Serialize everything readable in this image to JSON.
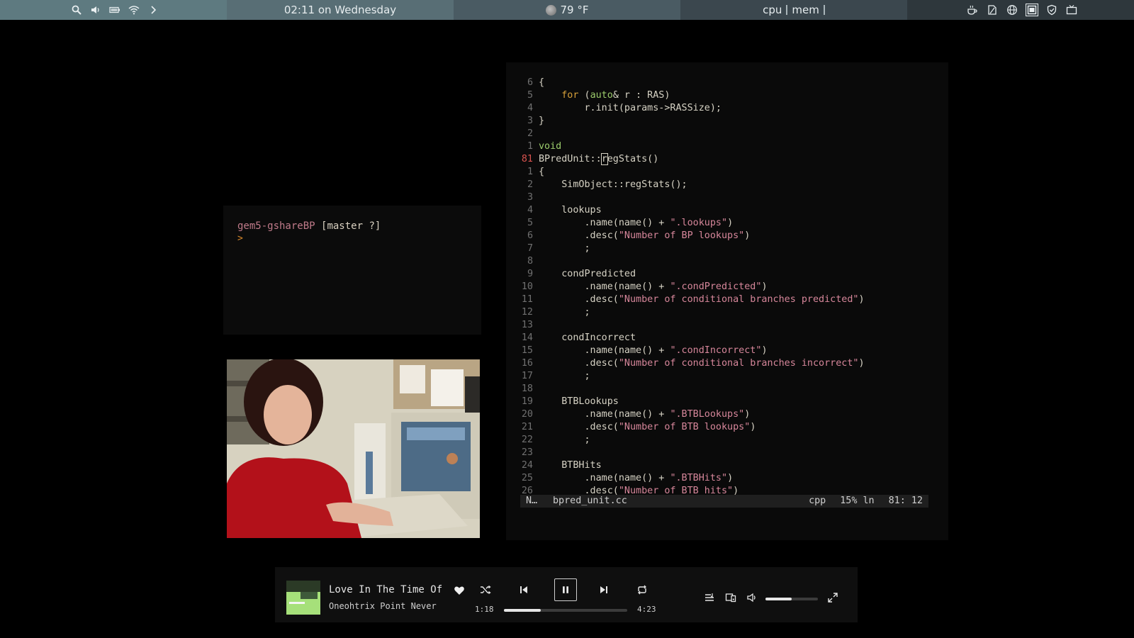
{
  "topbar": {
    "left_icons": [
      "search-icon",
      "volume-icon",
      "battery-icon",
      "wifi-icon",
      "chevron-right-icon"
    ],
    "clock": "02:11 on Wednesday",
    "weather": {
      "icon": "moon-icon",
      "temp": "79 °F"
    },
    "sys": {
      "cpu": "cpu",
      "mem": "mem"
    },
    "tray_icons": [
      "coffee-icon",
      "note-icon",
      "globe-icon",
      "window-icon",
      "shield-icon",
      "tv-icon"
    ]
  },
  "terminal": {
    "repo": "gem5-gshareBP",
    "branch": "[master ?]",
    "prompt": ">"
  },
  "editor": {
    "lines": [
      {
        "n": "6",
        "t": "{"
      },
      {
        "n": "5",
        "t": "    for (auto& r : RAS)"
      },
      {
        "n": "4",
        "t": "        r.init(params->RASSize);"
      },
      {
        "n": "3",
        "t": "}"
      },
      {
        "n": "2",
        "t": ""
      },
      {
        "n": "1",
        "t": "void"
      },
      {
        "n": "81",
        "t": "BPredUnit::regStats()",
        "current": true
      },
      {
        "n": "1",
        "t": "{"
      },
      {
        "n": "2",
        "t": "    SimObject::regStats();"
      },
      {
        "n": "3",
        "t": ""
      },
      {
        "n": "4",
        "t": "    lookups"
      },
      {
        "n": "5",
        "t": "        .name(name() + \".lookups\")"
      },
      {
        "n": "6",
        "t": "        .desc(\"Number of BP lookups\")"
      },
      {
        "n": "7",
        "t": "        ;"
      },
      {
        "n": "8",
        "t": ""
      },
      {
        "n": "9",
        "t": "    condPredicted"
      },
      {
        "n": "10",
        "t": "        .name(name() + \".condPredicted\")"
      },
      {
        "n": "11",
        "t": "        .desc(\"Number of conditional branches predicted\")"
      },
      {
        "n": "12",
        "t": "        ;"
      },
      {
        "n": "13",
        "t": ""
      },
      {
        "n": "14",
        "t": "    condIncorrect"
      },
      {
        "n": "15",
        "t": "        .name(name() + \".condIncorrect\")"
      },
      {
        "n": "16",
        "t": "        .desc(\"Number of conditional branches incorrect\")"
      },
      {
        "n": "17",
        "t": "        ;"
      },
      {
        "n": "18",
        "t": ""
      },
      {
        "n": "19",
        "t": "    BTBLookups"
      },
      {
        "n": "20",
        "t": "        .name(name() + \".BTBLookups\")"
      },
      {
        "n": "21",
        "t": "        .desc(\"Number of BTB lookups\")"
      },
      {
        "n": "22",
        "t": "        ;"
      },
      {
        "n": "23",
        "t": ""
      },
      {
        "n": "24",
        "t": "    BTBHits"
      },
      {
        "n": "25",
        "t": "        .name(name() + \".BTBHits\")"
      },
      {
        "n": "26",
        "t": "        .desc(\"Number of BTB hits\")"
      }
    ],
    "status": {
      "mode": "N…",
      "file": "bpred_unit.cc",
      "filetype": "cpp",
      "percent": "15% ln",
      "position": "81: 12"
    },
    "colors": {
      "keyword": "#d7a03a",
      "type": "#9ccc6c",
      "string": "#d6869a",
      "current_line_number": "#d9534f"
    }
  },
  "player": {
    "title": "Love In The Time Of",
    "artist": "Oneohtrix Point Never",
    "elapsed": "1:18",
    "duration": "4:23",
    "progress_fraction": 0.3,
    "volume_fraction": 0.5,
    "controls": [
      "shuffle-icon",
      "previous-icon",
      "pause-icon",
      "next-icon",
      "repeat-icon",
      "queue-icon",
      "devices-icon",
      "volume-icon",
      "fullscreen-icon"
    ]
  }
}
